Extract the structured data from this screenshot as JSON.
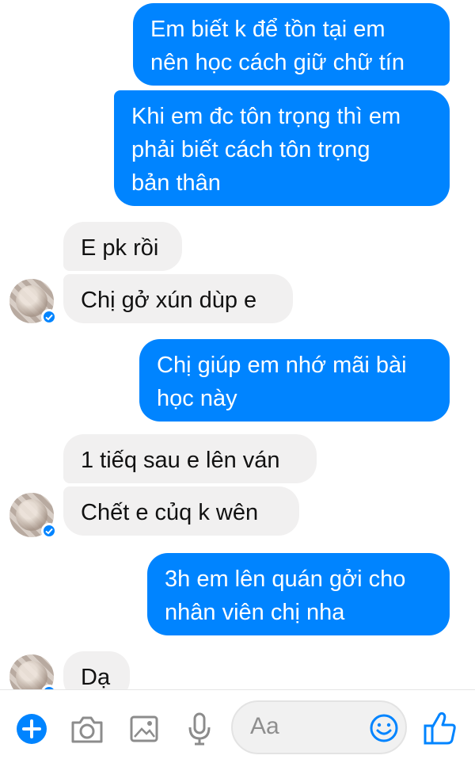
{
  "messages": [
    {
      "side": "out",
      "text": "Em biết k để tồn tại em\nnên học cách giữ chữ tín"
    },
    {
      "side": "out",
      "text": "Khi em đc tôn trọng thì em\nphải biết cách tôn trọng\nbản thân"
    },
    {
      "side": "in",
      "text": "E pk rồi"
    },
    {
      "side": "in",
      "text": "Chị gở xún dùp e"
    },
    {
      "side": "out",
      "text": "Chị giúp em nhớ mãi bài\nhọc này"
    },
    {
      "side": "in",
      "text": "1 tiếq sau e lên ván"
    },
    {
      "side": "in",
      "text": "Chết e củq k wên"
    },
    {
      "side": "out",
      "text": "3h em lên quán gởi cho\nnhân viên chị nha"
    },
    {
      "side": "in",
      "text": "Dạ"
    }
  ],
  "composer": {
    "placeholder": "Aa",
    "icons": [
      "plus-icon",
      "camera-icon",
      "image-icon",
      "microphone-icon",
      "emoji-icon",
      "thumbs-up-icon"
    ]
  },
  "colors": {
    "outgoing": "#0084ff",
    "incoming": "#f1f0f0",
    "accent": "#0084ff"
  }
}
